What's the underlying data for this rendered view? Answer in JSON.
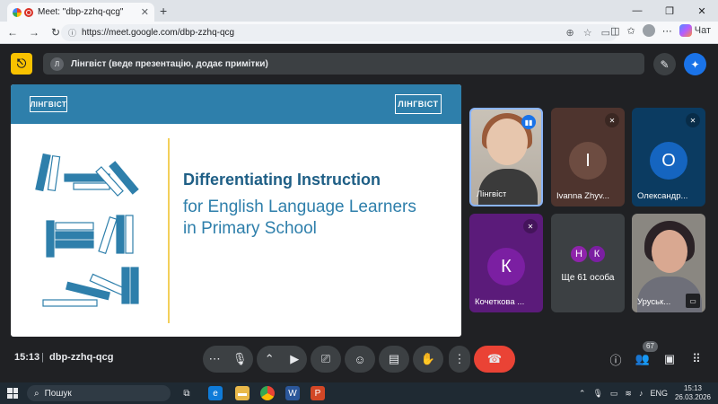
{
  "browser": {
    "tab_title": "Meet: \"dbp-zzhq-qcg\"",
    "tab_close": "✕",
    "new_tab": "+",
    "window_controls": [
      "—",
      "❐",
      "✕"
    ],
    "url": "https://meet.google.com/dbp-zzhq-qcg",
    "copilot_label": "Чат"
  },
  "meet": {
    "exit_icon": "exit-fullscreen-icon",
    "presenter_initial": "Л",
    "presenter_text": "Лінгвіст (веде презентацію, додає примітки)"
  },
  "slide": {
    "logo_left": "ЛІНГВІСТ",
    "logo_right": "ЛІНГВІСТ",
    "title": "Differentiating Instruction",
    "subtitle_line1": "for English Language Learners",
    "subtitle_line2": "in Primary School",
    "colors": {
      "header": "#2e7fab",
      "accent_line": "#f3cf5a",
      "title": "#1f5f86"
    }
  },
  "participants": [
    {
      "name": "Лінгвіст",
      "initial": "",
      "color": "",
      "mic": "speaking"
    },
    {
      "name": "Ivanna Zhyv...",
      "initial": "I",
      "color": "#6d4c41",
      "mic": "muted"
    },
    {
      "name": "Олександр...",
      "initial": "О",
      "color": "#1565c0",
      "mic": "muted"
    },
    {
      "name": "Кочеткова ...",
      "initial": "К",
      "color": "#7b1fa2",
      "mic": "muted"
    },
    {
      "name": "Уруськ...",
      "initial": "",
      "color": "",
      "mic": ""
    }
  ],
  "more": {
    "circle1": "Н",
    "circle2": "К",
    "label": "Ще 61 особа"
  },
  "bottom": {
    "time": "15:13",
    "separator": "|",
    "meeting_code": "dbp-zzhq-qcg",
    "people_count": "67"
  },
  "taskbar": {
    "search_label": "Пошук",
    "lang": "ENG",
    "time": "15:13",
    "date": "26.03.2026"
  }
}
